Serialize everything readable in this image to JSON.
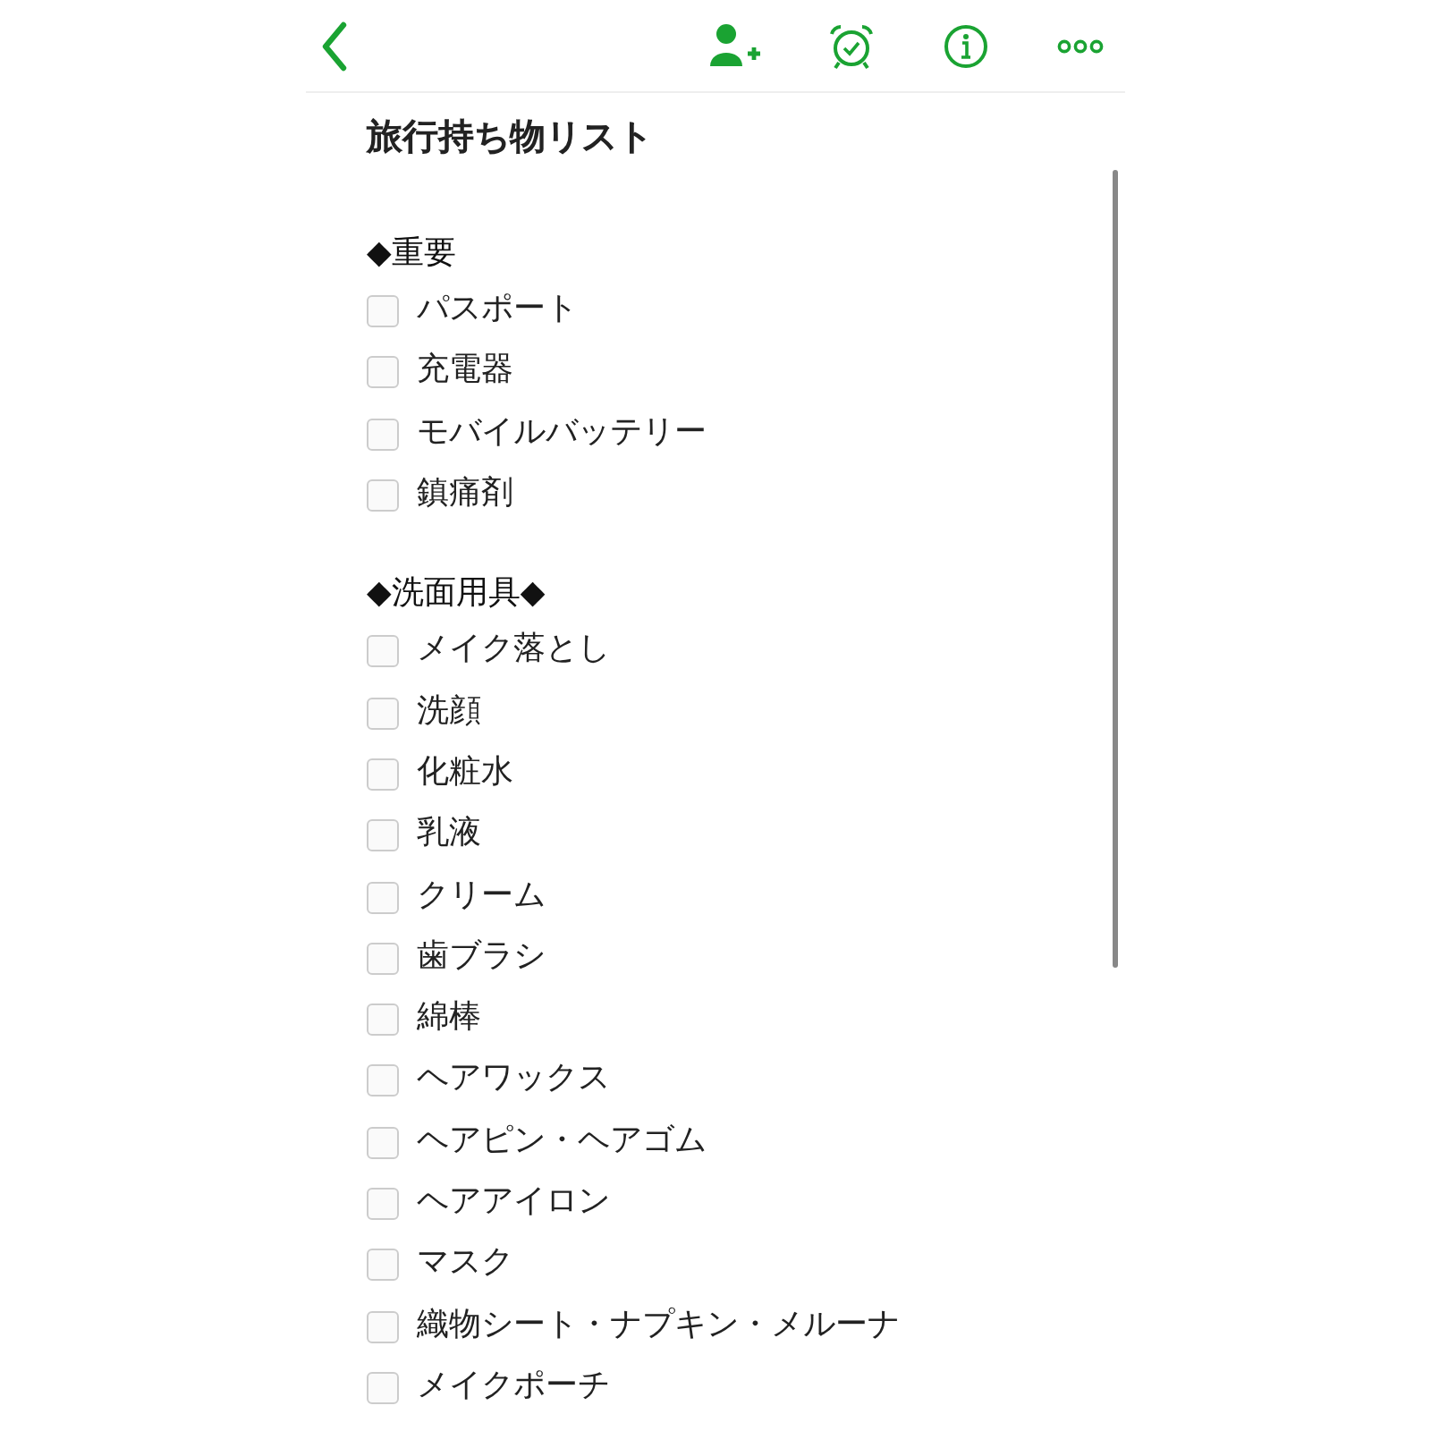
{
  "note": {
    "title": "旅行持ち物リスト",
    "sections": [
      {
        "heading": "◆重要",
        "items": [
          {
            "label": "パスポート",
            "checked": false
          },
          {
            "label": "充電器",
            "checked": false
          },
          {
            "label": "モバイルバッテリー",
            "checked": false
          },
          {
            "label": "鎮痛剤",
            "checked": false
          }
        ]
      },
      {
        "heading": "◆洗面用具◆",
        "items": [
          {
            "label": "メイク落とし",
            "checked": false
          },
          {
            "label": "洗顔",
            "checked": false
          },
          {
            "label": "化粧水",
            "checked": false
          },
          {
            "label": "乳液",
            "checked": false
          },
          {
            "label": "クリーム",
            "checked": false
          },
          {
            "label": "歯ブラシ",
            "checked": false
          },
          {
            "label": "綿棒",
            "checked": false
          },
          {
            "label": "ヘアワックス",
            "checked": false
          },
          {
            "label": "ヘアピン・ヘアゴム",
            "checked": false
          },
          {
            "label": "ヘアアイロン",
            "checked": false
          },
          {
            "label": "マスク",
            "checked": false
          },
          {
            "label": "織物シート・ナプキン・メルーナ",
            "checked": false
          },
          {
            "label": "メイクポーチ",
            "checked": false
          }
        ]
      }
    ]
  }
}
